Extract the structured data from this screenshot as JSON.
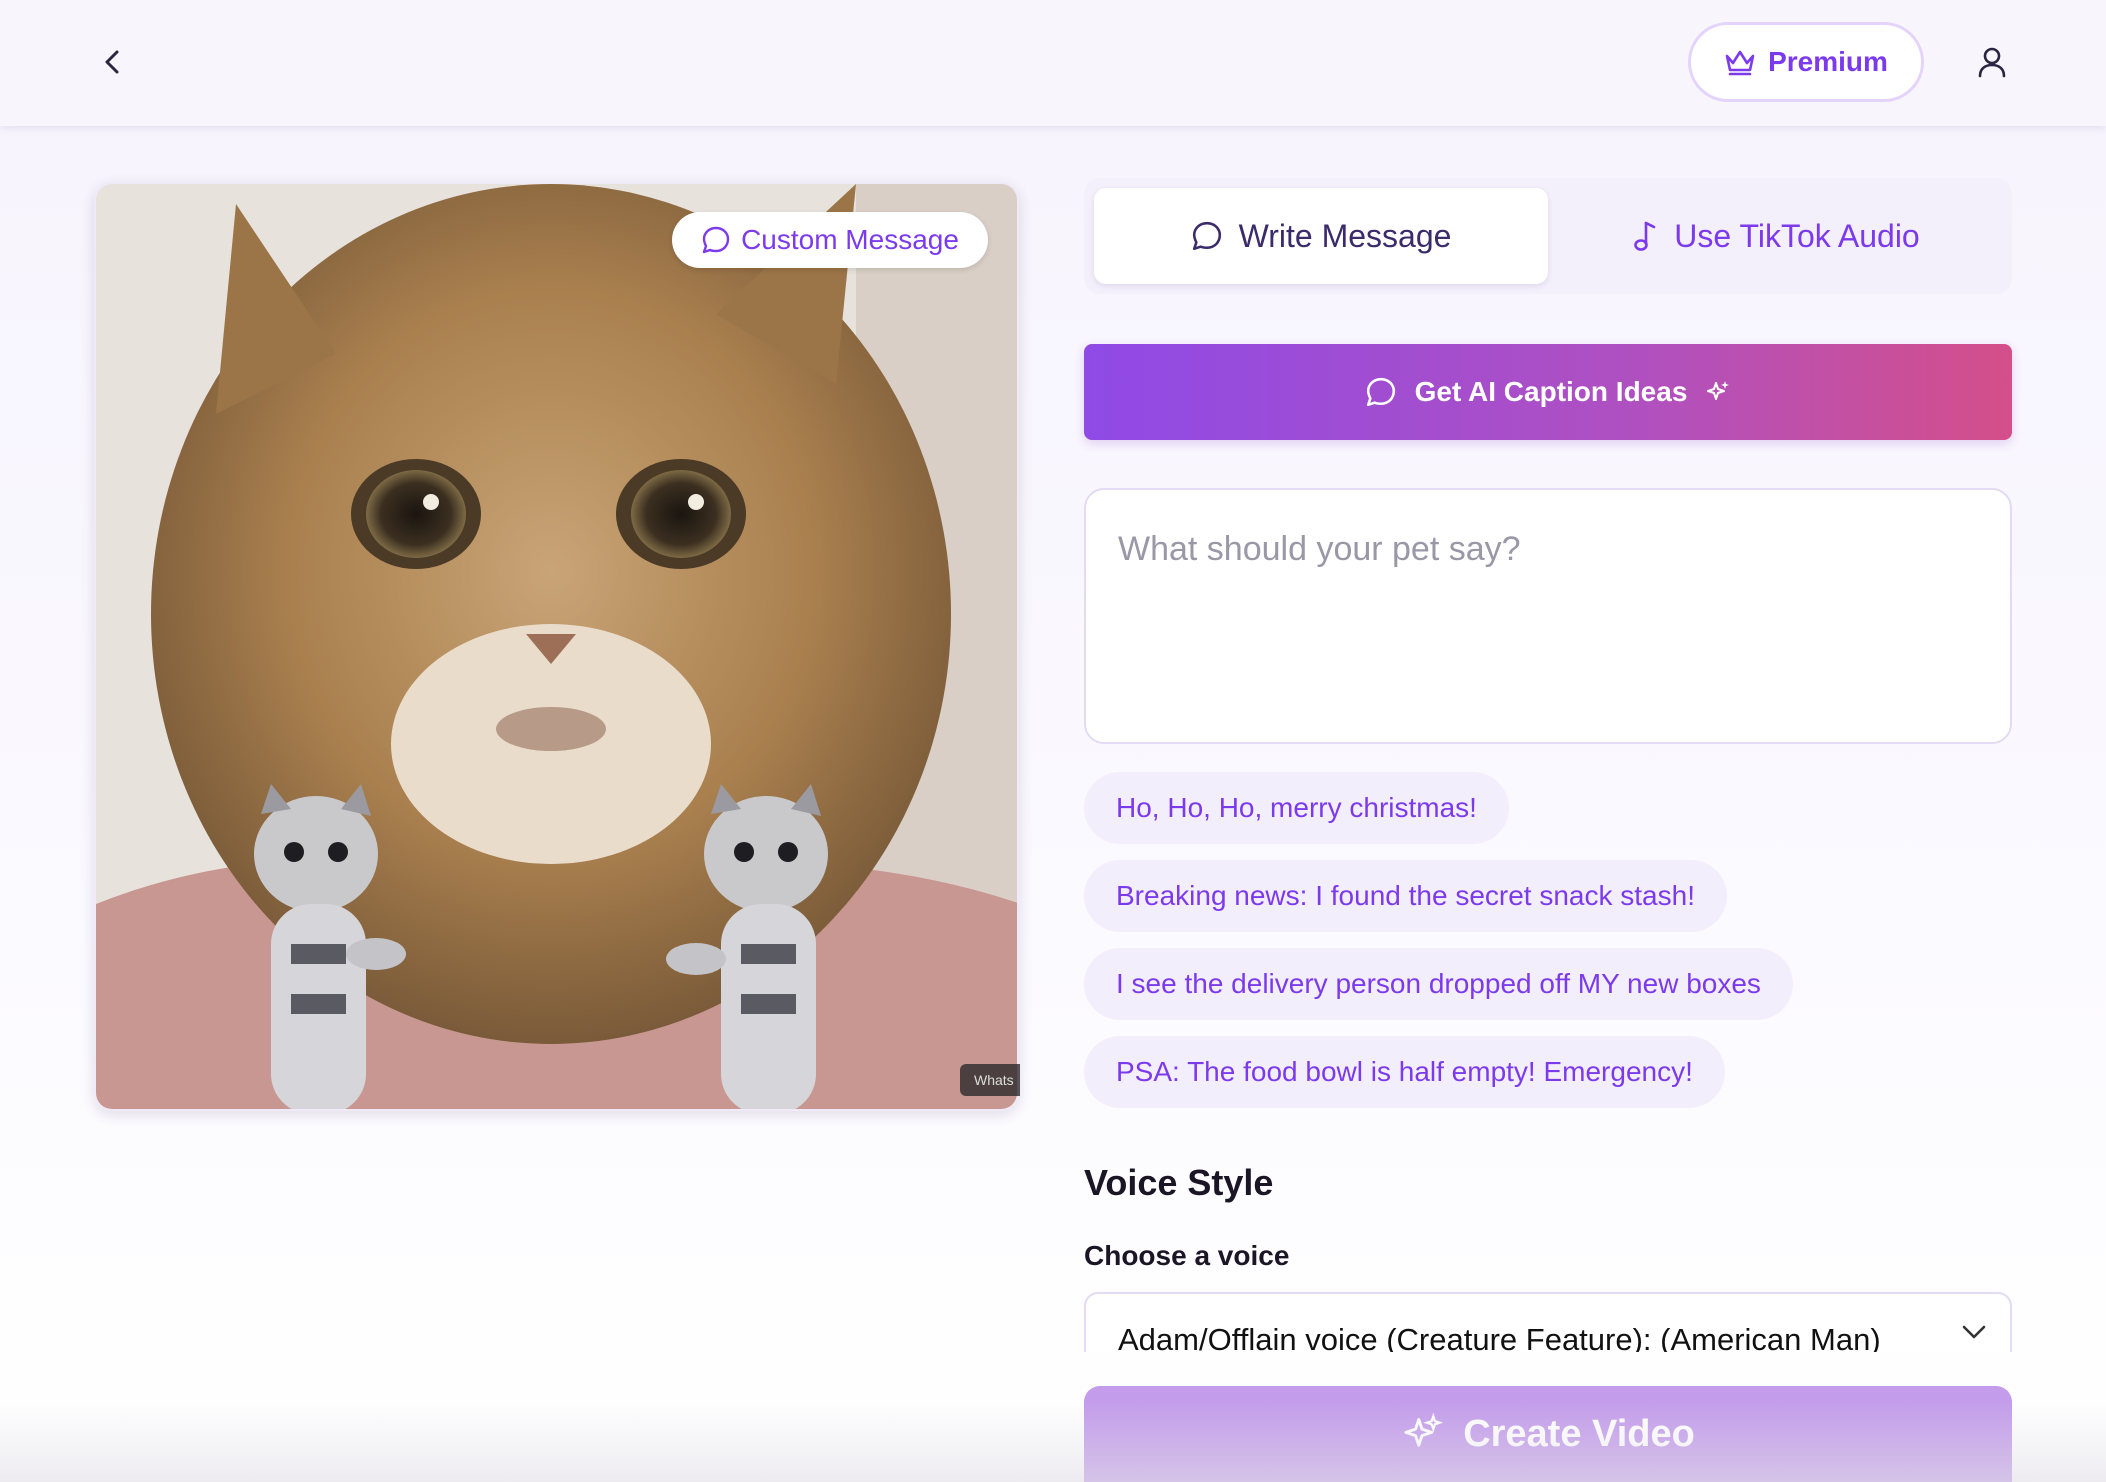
{
  "header": {
    "back_icon": "chevron-left-icon",
    "premium_label": "Premium",
    "premium_icon": "crown-icon",
    "user_icon": "user-icon"
  },
  "preview": {
    "badge_label": "Custom Message",
    "badge_icon": "message-circle-icon",
    "watermark_text": "Whats"
  },
  "tabs": [
    {
      "label": "Write Message",
      "icon": "message-circle-icon",
      "active": true
    },
    {
      "label": "Use TikTok Audio",
      "icon": "music-note-icon",
      "active": false
    }
  ],
  "ai_button": {
    "label": "Get AI Caption Ideas",
    "icon": "message-circle-icon",
    "trailing_icon": "sparkles-icon"
  },
  "message_input": {
    "placeholder": "What should your pet say?",
    "value": ""
  },
  "suggestions": [
    "Ho, Ho, Ho, merry christmas!",
    "Breaking news: I found the secret snack stash!",
    "I see the delivery person dropped off MY new boxes",
    "PSA: The food bowl is half empty! Emergency!"
  ],
  "voice": {
    "section_title": "Voice Style",
    "choose_label": "Choose a voice",
    "selected": "Adam/Offlain voice (Creature Feature): (American Man)"
  },
  "create_button": {
    "label": "Create Video",
    "icon": "sparkles-icon"
  },
  "colors": {
    "accent": "#7c3aed",
    "gradient_start": "#8f4ae6",
    "gradient_end": "#d44f8a",
    "create_button": "#c39ceb"
  }
}
